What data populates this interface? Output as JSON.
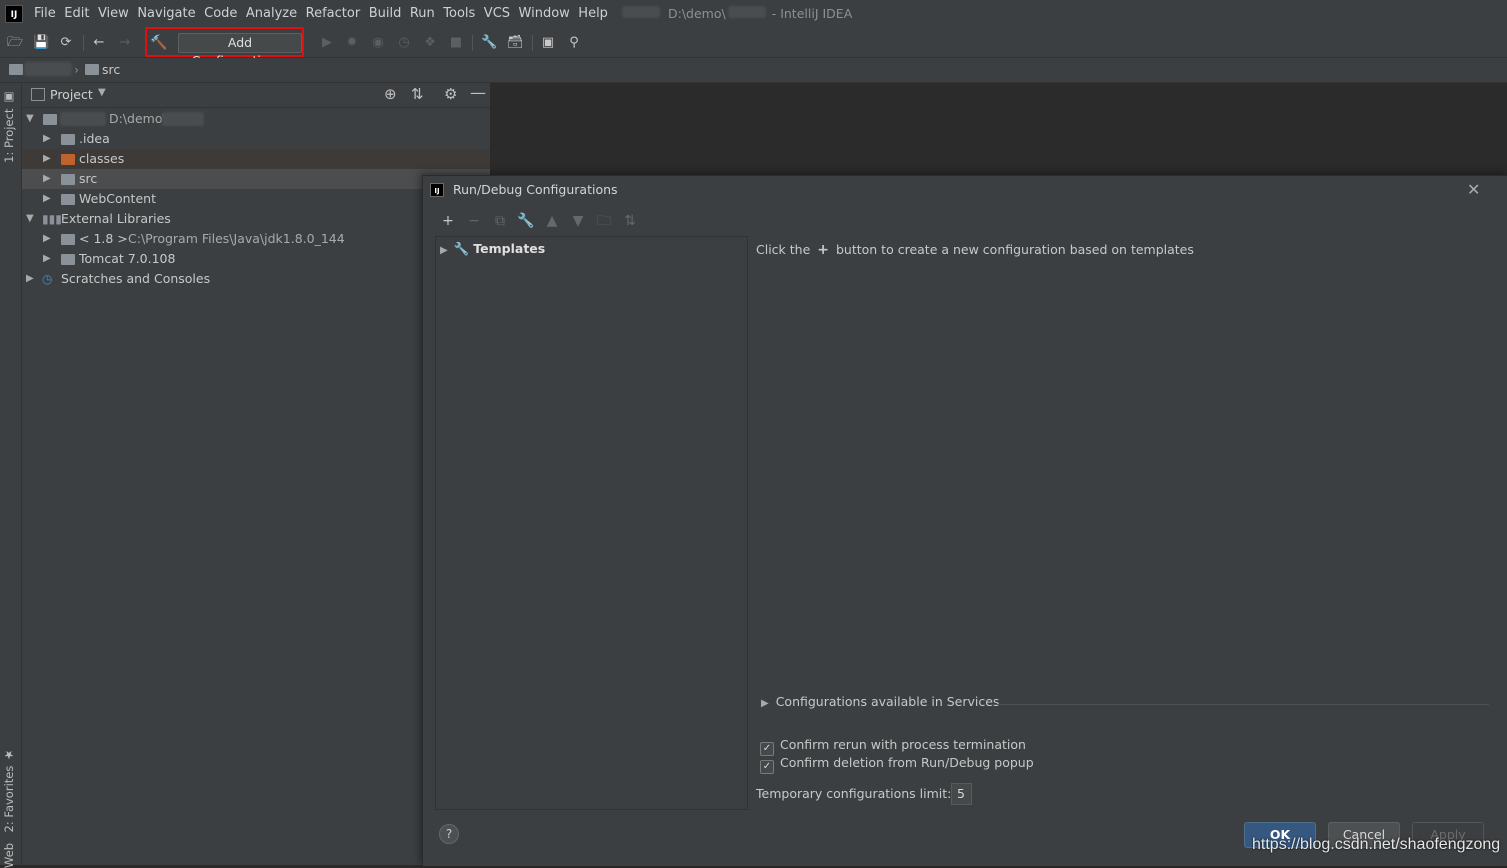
{
  "menubar": {
    "items": [
      "File",
      "Edit",
      "View",
      "Navigate",
      "Code",
      "Analyze",
      "Refactor",
      "Build",
      "Run",
      "Tools",
      "VCS",
      "Window",
      "Help"
    ],
    "window_title_path": "D:\\demo\\",
    "window_title_app": "- IntelliJ IDEA"
  },
  "toolbar": {
    "add_configuration_label": "Add Configuration..."
  },
  "breadcrumb": {
    "current": "src"
  },
  "side_tabs": {
    "project": "1: Project",
    "favorites": "2: Favorites",
    "web": "Web"
  },
  "project_panel": {
    "title": "Project",
    "tree": [
      {
        "label": "D:\\demo\\"
      },
      {
        "label": ".idea"
      },
      {
        "label": "classes"
      },
      {
        "label": "src"
      },
      {
        "label": "WebContent"
      },
      {
        "label": "External Libraries"
      },
      {
        "label": "< 1.8 >",
        "detail": "C:\\Program Files\\Java\\jdk1.8.0_144"
      },
      {
        "label": "Tomcat 7.0.108"
      },
      {
        "label": "Scratches and Consoles"
      }
    ]
  },
  "dialog": {
    "title": "Run/Debug Configurations",
    "templates_label": "Templates",
    "hint_before": "Click the",
    "hint_after": "button to create a new configuration based on templates",
    "services_label": "Configurations available in Services",
    "confirm_rerun_label": "Confirm rerun with process termination",
    "confirm_deletion_label": "Confirm deletion from Run/Debug popup",
    "temp_limit_label": "Temporary configurations limit:",
    "temp_limit_value": "5",
    "ok_label": "OK",
    "cancel_label": "Cancel",
    "apply_label": "Apply"
  },
  "watermark": "https://blog.csdn.net/shaofengzong",
  "colors": {
    "highlight_box": "#e01010",
    "ok_button": "#365880",
    "hammer_icon": "#56a82a",
    "classes_folder": "#c0622e"
  }
}
